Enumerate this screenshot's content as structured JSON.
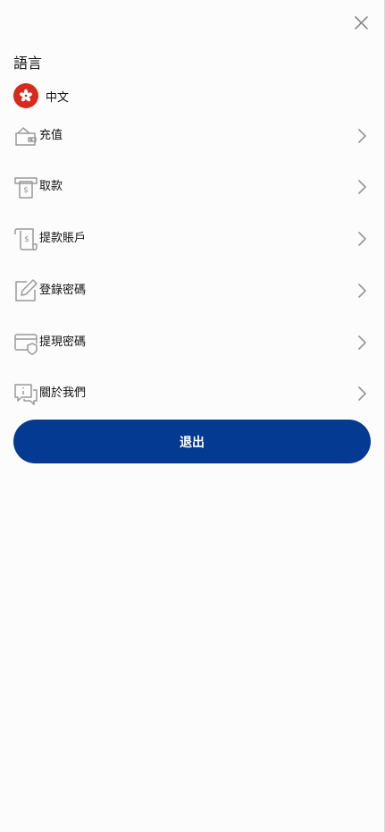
{
  "drawer": {
    "close_icon": "close-icon"
  },
  "language": {
    "title": "語言",
    "flag_icon": "hong-kong-flag-icon",
    "current": "中文"
  },
  "menu": [
    {
      "label": "充值",
      "icon": "wallet-icon"
    },
    {
      "label": "取款",
      "icon": "atm-withdraw-icon"
    },
    {
      "label": "提款賬戶",
      "icon": "receipt-account-icon"
    },
    {
      "label": "登錄密碼",
      "icon": "edit-pencil-icon"
    },
    {
      "label": "提現密碼",
      "icon": "card-shield-icon"
    },
    {
      "label": "關於我們",
      "icon": "info-chat-icon"
    }
  ],
  "logout": {
    "label": "退出"
  },
  "colors": {
    "primary_button": "#053a92",
    "flag_red": "#d8291e",
    "icon_gray": "#9a9a9a",
    "background": "#fcfcfc"
  }
}
